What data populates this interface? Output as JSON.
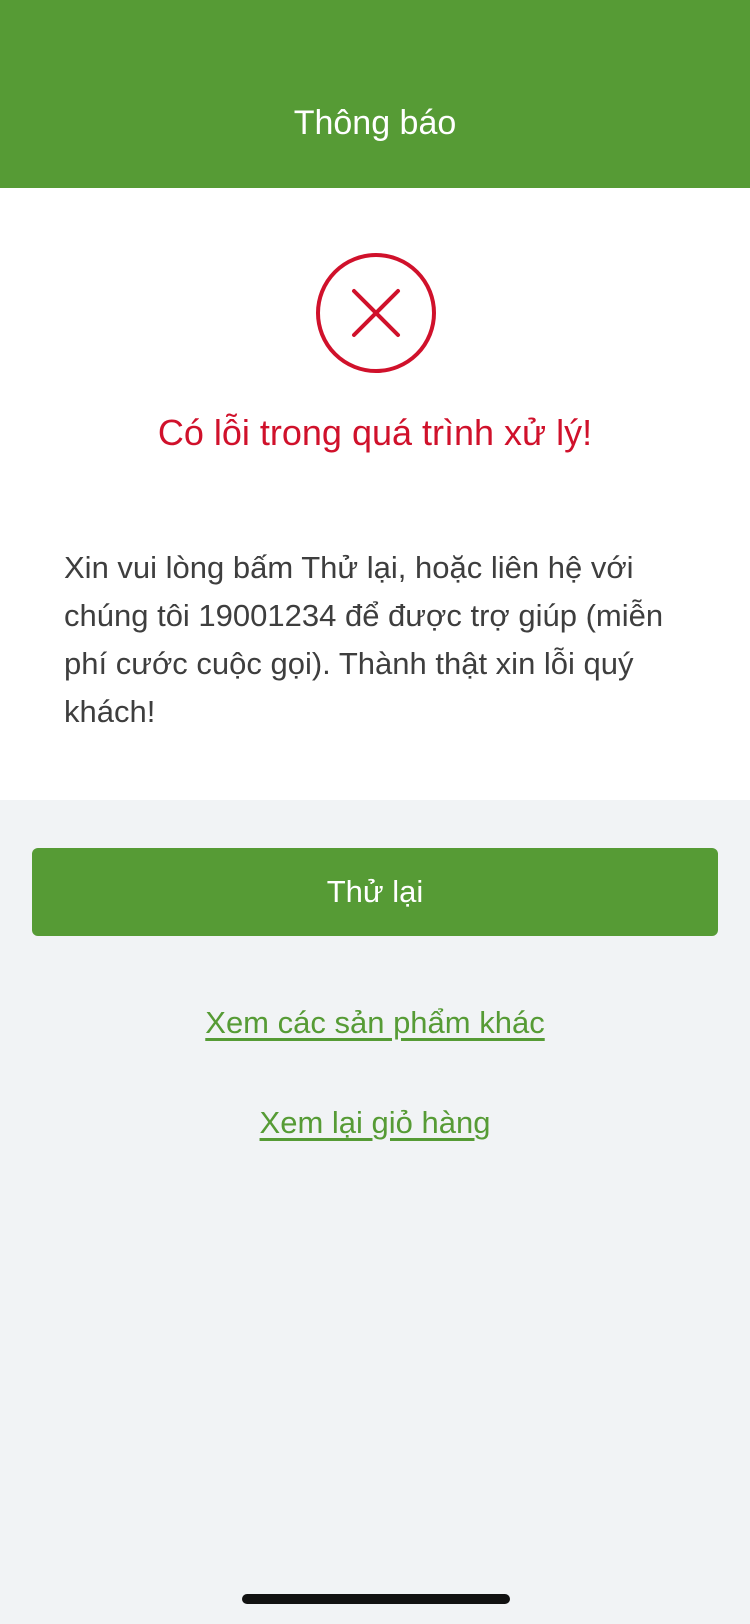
{
  "header": {
    "title": "Thông báo",
    "background_color": "#569b35"
  },
  "error": {
    "icon": "close-circle-icon",
    "icon_color": "#d0112b",
    "title": "Có lỗi trong quá trình xử lý!",
    "message": "Xin vui lòng bấm Thử lại, hoặc liên hệ với chúng tôi 19001234 để được trợ giúp (miễn phí cước cuộc gọi). Thành thật xin lỗi quý khách!"
  },
  "actions": {
    "retry_label": "Thử lại",
    "other_products_label": "Xem các sản phẩm khác",
    "cart_label": "Xem lại giỏ hàng",
    "accent_color": "#569b35"
  }
}
